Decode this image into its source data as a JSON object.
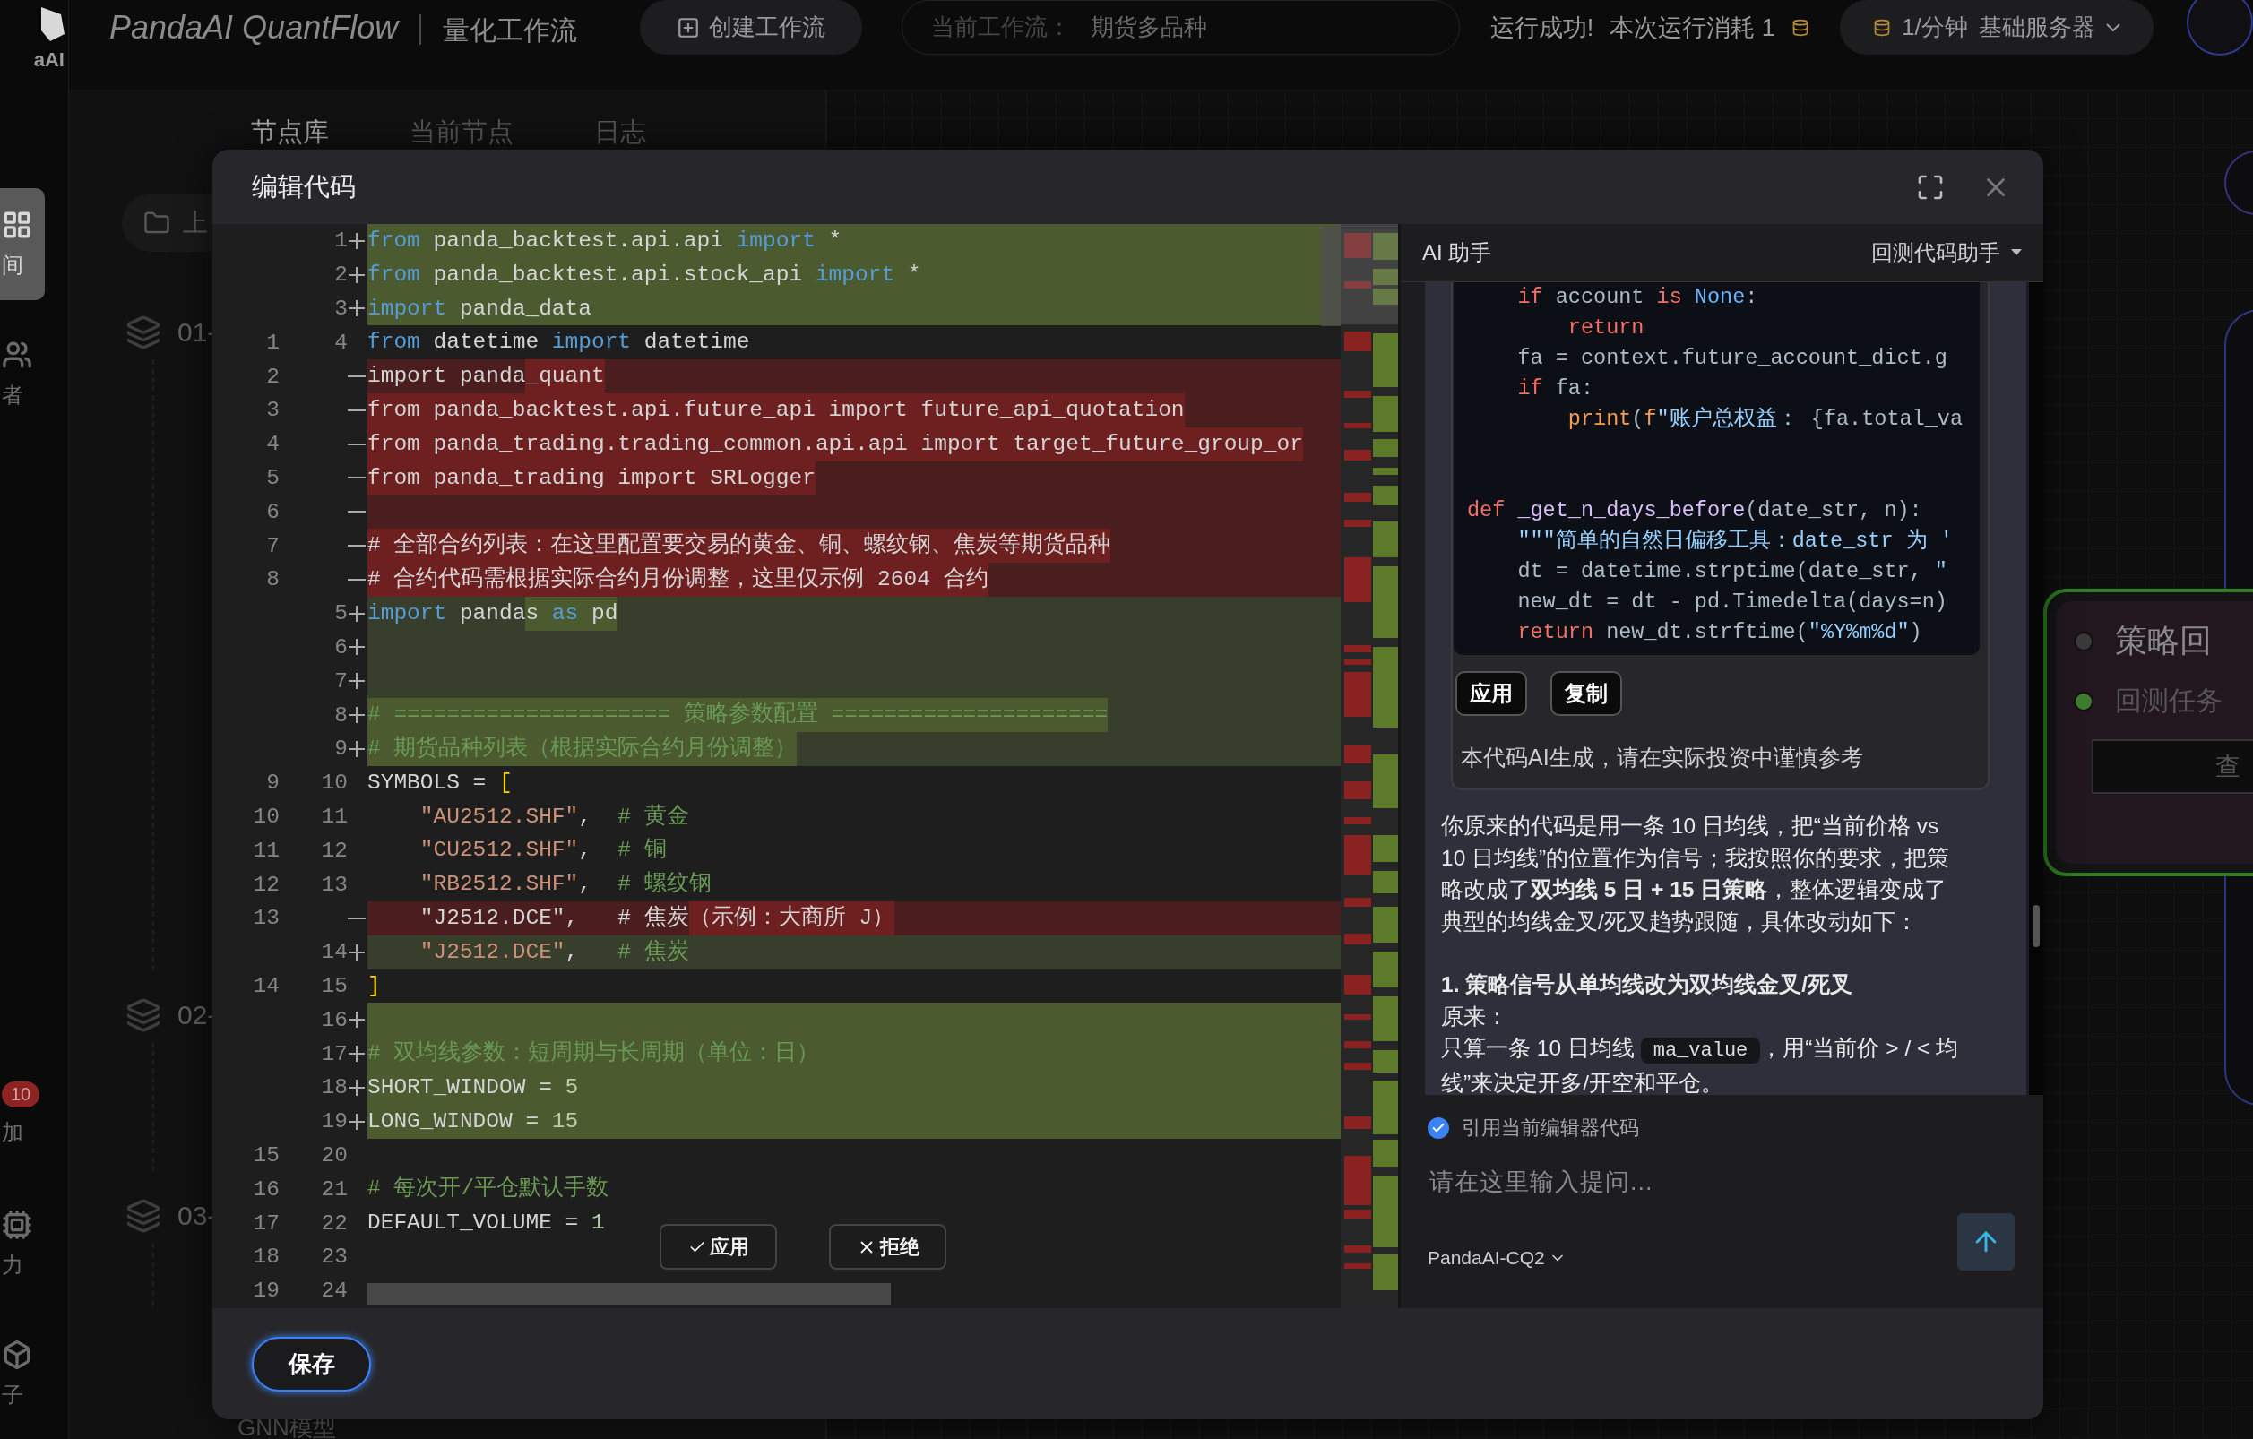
{
  "app_bar": {
    "logo_text": "aAI",
    "brand": "PandaAI QuantFlow",
    "subtitle": "量化工作流",
    "create_button": "创建工作流",
    "workflow_label": "当前工作流：",
    "workflow_name": "期货多品种",
    "run_status": "运行成功!",
    "cost": "本次运行消耗 1",
    "server_rate": "1/分钟",
    "server_name": "基础服务器"
  },
  "rail": [
    {
      "label": "间",
      "selected": true
    },
    {
      "label": "者",
      "selected": false
    },
    {
      "label": "加",
      "selected": false,
      "badge": "10"
    },
    {
      "label": "力",
      "selected": false
    },
    {
      "label": "子",
      "selected": false
    }
  ],
  "panel_tabs": [
    {
      "label": "节点库",
      "selected": true
    },
    {
      "label": "当前节点",
      "selected": false
    },
    {
      "label": "日志",
      "selected": false
    }
  ],
  "node_library": {
    "folder_button": "上",
    "groups": [
      "01-",
      "02-",
      "03-"
    ],
    "bottom_item": "GNN模型"
  },
  "canvas_node": {
    "title": "策略回",
    "port": "回测任务",
    "button": "查"
  },
  "modal": {
    "title": "编辑代码",
    "save_button": "保存"
  },
  "editor": {
    "lines": [
      {
        "new": "1",
        "kind": "add",
        "full": true,
        "segs": [
          {
            "t": "from",
            "kind": "keyword"
          },
          {
            "t": " panda_backtest.api.api "
          },
          {
            "t": "import",
            "kind": "keyword"
          },
          {
            "t": " *"
          }
        ]
      },
      {
        "new": "2",
        "kind": "add",
        "full": true,
        "segs": [
          {
            "t": "from",
            "kind": "keyword"
          },
          {
            "t": " panda_backtest.api.stock_api "
          },
          {
            "t": "import",
            "kind": "keyword"
          },
          {
            "t": " *"
          }
        ]
      },
      {
        "new": "3",
        "kind": "add",
        "full": true,
        "segs": [
          {
            "t": "import",
            "kind": "keyword"
          },
          {
            "t": " panda_data"
          }
        ]
      },
      {
        "old": "1",
        "new": "4",
        "kind": "same",
        "segs": [
          {
            "t": "from",
            "kind": "keyword"
          },
          {
            "t": " datetime "
          },
          {
            "t": "import",
            "kind": "keyword"
          },
          {
            "t": " datetime"
          }
        ]
      },
      {
        "old": "2",
        "kind": "del",
        "segs": [
          {
            "t": "import panda"
          },
          {
            "t": "_quant",
            "hl": true
          }
        ]
      },
      {
        "old": "3",
        "kind": "del",
        "segs": [
          {
            "t": "from panda_backtest.api.future_api import future_api_quotation",
            "hl": true
          }
        ]
      },
      {
        "old": "4",
        "kind": "del",
        "segs": [
          {
            "t": "from panda_trading.trading_common.api.api import target_future_group_or",
            "hl": true
          }
        ]
      },
      {
        "old": "5",
        "kind": "del",
        "segs": [
          {
            "t": "from panda_trading import SRLogger",
            "hl": true
          }
        ]
      },
      {
        "old": "6",
        "kind": "del"
      },
      {
        "old": "7",
        "kind": "del",
        "segs": [
          {
            "t": "# 全部合约列表：在这里配置要交易的黄金、铜、螺纹钢、焦炭等期货品种",
            "hl": true
          }
        ]
      },
      {
        "old": "8",
        "kind": "del",
        "segs": [
          {
            "t": "# 合约代码需根据实际合约月份调整，这里仅示例 2604 合约",
            "hl": true
          }
        ]
      },
      {
        "new": "5",
        "kind": "add",
        "full": false,
        "segs": [
          {
            "t": "import",
            "kind": "keyword"
          },
          {
            "t": " panda"
          },
          {
            "t": "s ",
            "hl": true
          },
          {
            "t": "as",
            "kind": "keyword",
            "hl": true
          },
          {
            "t": " pd",
            "hl": true
          }
        ]
      },
      {
        "new": "6",
        "kind": "add",
        "full": false
      },
      {
        "new": "7",
        "kind": "add",
        "full": false
      },
      {
        "new": "8",
        "kind": "add",
        "full": false,
        "segs": [
          {
            "t": "# ===================== 策略参数配置 =====================",
            "kind": "comment",
            "hl": true
          }
        ]
      },
      {
        "new": "9",
        "kind": "add",
        "full": false,
        "segs": [
          {
            "t": "# 期货品种列表（根据实际合约月份调整）",
            "kind": "comment",
            "hl": true
          }
        ]
      },
      {
        "old": "9",
        "new": "10",
        "kind": "same",
        "segs": [
          {
            "t": "SYMBOLS = "
          },
          {
            "t": "[",
            "kind": "bracket"
          }
        ]
      },
      {
        "old": "10",
        "new": "11",
        "kind": "same",
        "segs": [
          {
            "t": "    \"AU2512.SHF\"",
            "kind": "string"
          },
          {
            "t": ",  "
          },
          {
            "t": "# 黄金",
            "kind": "comment"
          }
        ]
      },
      {
        "old": "11",
        "new": "12",
        "kind": "same",
        "segs": [
          {
            "t": "    \"CU2512.SHF\"",
            "kind": "string"
          },
          {
            "t": ",  "
          },
          {
            "t": "# 铜",
            "kind": "comment"
          }
        ]
      },
      {
        "old": "12",
        "new": "13",
        "kind": "same",
        "segs": [
          {
            "t": "    \"RB2512.SHF\"",
            "kind": "string"
          },
          {
            "t": ",  "
          },
          {
            "t": "# 螺纹钢",
            "kind": "comment"
          }
        ]
      },
      {
        "old": "13",
        "kind": "del",
        "segs": [
          {
            "t": "    \"J2512.DCE\",   # 焦炭"
          },
          {
            "t": "（示例：大商所 J）",
            "hl": true
          }
        ]
      },
      {
        "new": "14",
        "kind": "add",
        "full": false,
        "segs": [
          {
            "t": "    \"J2512.DCE\"",
            "kind": "string"
          },
          {
            "t": ",   "
          },
          {
            "t": "# 焦炭",
            "kind": "comment"
          }
        ]
      },
      {
        "old": "14",
        "new": "15",
        "kind": "same",
        "segs": [
          {
            "t": "]",
            "kind": "bracket"
          }
        ]
      },
      {
        "new": "16",
        "kind": "add",
        "full": true
      },
      {
        "new": "17",
        "kind": "add",
        "full": true,
        "segs": [
          {
            "t": "# 双均线参数：短周期与长周期（单位：日）",
            "kind": "comment"
          }
        ]
      },
      {
        "new": "18",
        "kind": "add",
        "full": true,
        "segs": [
          {
            "t": "SHORT_WINDOW = "
          },
          {
            "t": "5",
            "kind": "number"
          }
        ]
      },
      {
        "new": "19",
        "kind": "add",
        "full": true,
        "segs": [
          {
            "t": "LONG_WINDOW = "
          },
          {
            "t": "15",
            "kind": "number"
          }
        ]
      },
      {
        "old": "15",
        "new": "20",
        "kind": "same"
      },
      {
        "old": "16",
        "new": "21",
        "kind": "same",
        "segs": [
          {
            "t": "# 每次开/平仓默认手数",
            "kind": "comment"
          }
        ]
      },
      {
        "old": "17",
        "new": "22",
        "kind": "same",
        "segs": [
          {
            "t": "DEFAULT_VOLUME = "
          },
          {
            "t": "1",
            "kind": "number"
          }
        ]
      },
      {
        "old": "18",
        "new": "23",
        "kind": "same"
      },
      {
        "old": "19",
        "new": "24",
        "kind": "same"
      }
    ],
    "diff_actions": [
      {
        "label": "应用",
        "kind": "accept"
      },
      {
        "label": "拒绝",
        "kind": "reject"
      }
    ]
  },
  "ai_panel": {
    "title": "AI 助手",
    "assistant": "回测代码助手",
    "code_lines": [
      {
        "kind": "code",
        "segs": [
          {
            "t": "    if",
            "kind": "keyword"
          },
          {
            "t": " account "
          },
          {
            "t": "is",
            "kind": "keyword"
          },
          {
            "t": " None",
            "kind": "constant"
          },
          {
            "t": ":"
          }
        ]
      },
      {
        "kind": "code",
        "segs": [
          {
            "t": "        return",
            "kind": "keyword"
          }
        ]
      },
      {
        "kind": "code",
        "segs": [
          {
            "t": "    fa = context.future_account_dict.g"
          }
        ]
      },
      {
        "kind": "code",
        "segs": [
          {
            "t": "    if",
            "kind": "keyword"
          },
          {
            "t": " fa:"
          }
        ]
      },
      {
        "kind": "code",
        "segs": [
          {
            "t": "        print",
            "kind": "builtin"
          },
          {
            "t": "("
          },
          {
            "t": "f",
            "kind": "builtin"
          },
          {
            "t": "\"账户总权益：",
            "kind": "string"
          },
          {
            "t": " {fa.total_va"
          }
        ]
      },
      {
        "kind": "blank"
      },
      {
        "kind": "blank"
      },
      {
        "kind": "code",
        "segs": [
          {
            "t": "def",
            "kind": "keyword"
          },
          {
            "t": " _get_n_days_before",
            "kind": "function"
          },
          {
            "t": "(date_str, n):"
          }
        ]
      },
      {
        "kind": "code",
        "segs": [
          {
            "t": "    \"\"\"简单的自然日偏移工具：date_str 为 '",
            "kind": "string"
          }
        ]
      },
      {
        "kind": "code",
        "segs": [
          {
            "t": "    dt = datetime.strptime(date_str, "
          },
          {
            "t": "\"",
            "kind": "string"
          }
        ]
      },
      {
        "kind": "code",
        "segs": [
          {
            "t": "    new_dt = dt - pd.Timedelta(days=n)"
          }
        ]
      },
      {
        "kind": "code",
        "segs": [
          {
            "t": "    return",
            "kind": "keyword"
          },
          {
            "t": " new_dt.strftime("
          },
          {
            "t": "\"%Y%m%d\"",
            "kind": "string"
          },
          {
            "t": ")"
          }
        ]
      }
    ],
    "card_buttons": [
      "应用",
      "复制"
    ],
    "disclaimer": "本代码AI生成，请在实际投资中谨慎参考",
    "message": [
      {
        "kind": "text",
        "text": "你原来的代码是用一条 10 日均线，把“当前价格 vs 10 日均线”的位置作为信号；我按照你的要求，把策略改成了**双均线 5 日 + 15 日策略**，整体逻辑变成了典型的均线金叉/死叉趋势跟随，具体改动如下："
      },
      {
        "kind": "heading",
        "text": "1. 策略信号从单均线改为双均线金叉/死叉"
      },
      {
        "kind": "text",
        "text": "原来："
      },
      {
        "kind": "code_text",
        "before": "只算一条 10 日均线",
        "code": "ma_value",
        "after": "，用“当前价 > / < 均线”来决定开多/开空和平仓。"
      }
    ],
    "quote_code": {
      "label": "引用当前编辑器代码",
      "checked": true
    },
    "input": {
      "placeholder": "请在这里输入提问..."
    },
    "model": "PandaAI-CQ2"
  }
}
